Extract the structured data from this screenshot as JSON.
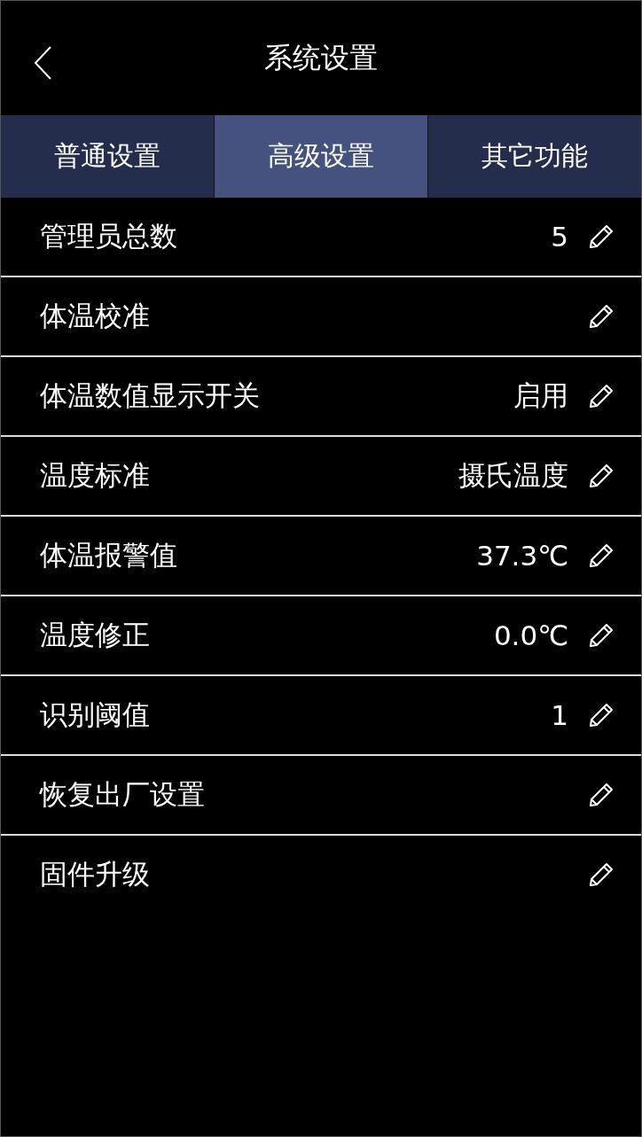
{
  "header": {
    "title": "系统设置"
  },
  "tabs": [
    {
      "label": "普通设置",
      "selected": false
    },
    {
      "label": "高级设置",
      "selected": true
    },
    {
      "label": "其它功能",
      "selected": false
    }
  ],
  "settings": [
    {
      "label": "管理员总数",
      "value": "5"
    },
    {
      "label": "体温校准"
    },
    {
      "label": "体温数值显示开关",
      "value": "启用"
    },
    {
      "label": "温度标准",
      "value": "摄氏温度"
    },
    {
      "label": "体温报警值",
      "value": "37.3℃"
    },
    {
      "label": "温度修正",
      "value": "0.0℃"
    },
    {
      "label": "识别阈值",
      "value": "1"
    },
    {
      "label": "恢复出厂设置"
    },
    {
      "label": "固件升级"
    }
  ]
}
